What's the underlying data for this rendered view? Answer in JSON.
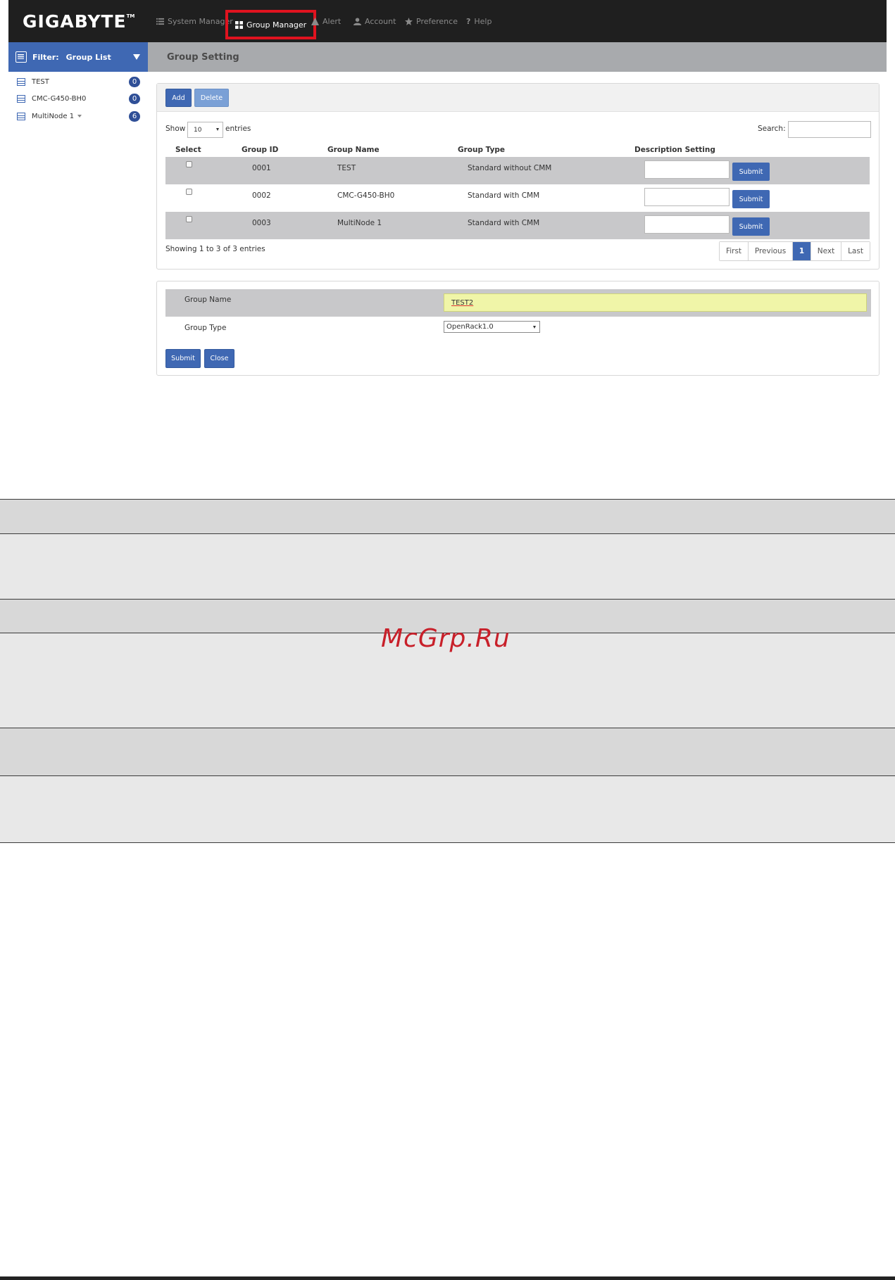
{
  "navbar": {
    "logo": "GIGABYTE",
    "logo_tm": "TM",
    "items": [
      {
        "label": "System Manager",
        "icon": "list-icon"
      },
      {
        "label": "Group Manager",
        "icon": "grid-icon",
        "active": true
      },
      {
        "label": "Alert",
        "icon": "warning-icon"
      },
      {
        "label": "Account",
        "icon": "user-icon"
      },
      {
        "label": "Preference",
        "icon": "star-icon"
      },
      {
        "label": "Help",
        "icon": "question-icon"
      }
    ]
  },
  "sidebar": {
    "filter_label": "Filter:",
    "filter_value": "Group List",
    "items": [
      {
        "label": "TEST",
        "count": "0",
        "icon": "server-icon"
      },
      {
        "label": "CMC-G450-BH0",
        "count": "0",
        "icon": "server-icon"
      },
      {
        "label": "MultiNode 1",
        "count": "6",
        "icon": "server-icon",
        "expandable": true
      }
    ]
  },
  "content": {
    "title": "Group Setting"
  },
  "group_table": {
    "add_label": "Add",
    "delete_label": "Delete",
    "show_label": "Show",
    "page_size": "10",
    "entries_label": "entries",
    "search_label": "Search:",
    "headers": [
      "Select",
      "Group ID",
      "Group Name",
      "Group Type",
      "Description Setting"
    ],
    "rows": [
      {
        "id": "0001",
        "name": "TEST",
        "type": "Standard without CMM",
        "submit": "Submit"
      },
      {
        "id": "0002",
        "name": "CMC-G450-BH0",
        "type": "Standard with CMM",
        "submit": "Submit"
      },
      {
        "id": "0003",
        "name": "MultiNode 1",
        "type": "Standard with CMM",
        "submit": "Submit"
      }
    ],
    "info": "Showing 1 to 3 of 3 entries",
    "pagination": [
      "First",
      "Previous",
      "1",
      "Next",
      "Last"
    ]
  },
  "group_form": {
    "name_label": "Group Name",
    "name_value": "TEST2",
    "type_label": "Group Type",
    "type_value": "OpenRack1.0",
    "submit_label": "Submit",
    "close_label": "Close"
  },
  "watermark": "McGrp.Ru",
  "colors": {
    "accent": "#3f68b3",
    "navbar": "#1f1f1f",
    "highlight": "#e0131f",
    "input_highlight": "#f0f5a8"
  }
}
